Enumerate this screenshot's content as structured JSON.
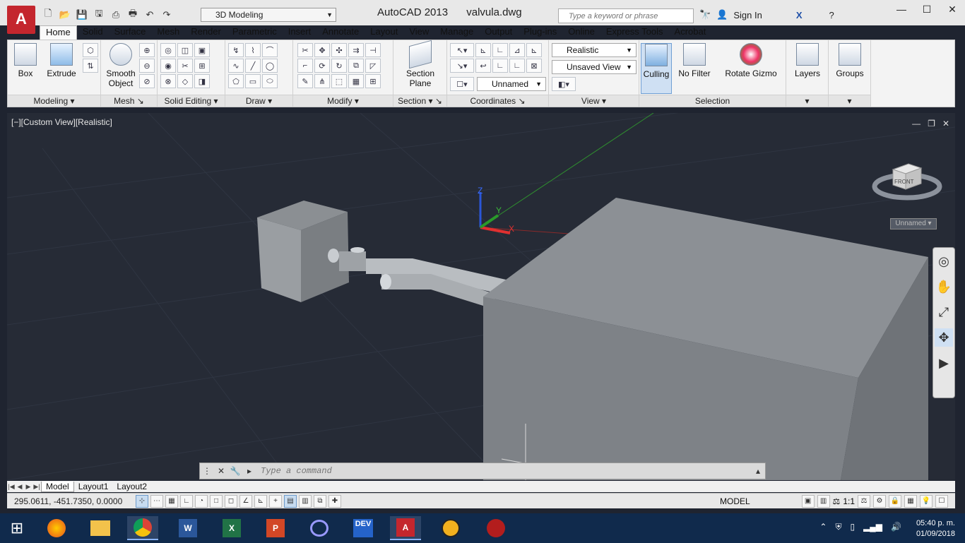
{
  "titlebar": {
    "app_name": "AutoCAD 2013",
    "file_name": "valvula.dwg",
    "workspace": "3D Modeling",
    "search_placeholder": "Type a keyword or phrase",
    "sign_in": "Sign In"
  },
  "tabs": [
    "Home",
    "Solid",
    "Surface",
    "Mesh",
    "Render",
    "Parametric",
    "Insert",
    "Annotate",
    "Layout",
    "View",
    "Manage",
    "Output",
    "Plug-ins",
    "Online",
    "Express Tools",
    "Acrobat"
  ],
  "active_tab": "Home",
  "ribbon": {
    "modeling": {
      "title": "Modeling",
      "box": "Box",
      "extrude": "Extrude"
    },
    "mesh": {
      "title": "Mesh",
      "smooth_object_line1": "Smooth",
      "smooth_object_line2": "Object"
    },
    "solid_editing": {
      "title": "Solid Editing"
    },
    "draw": {
      "title": "Draw"
    },
    "modify": {
      "title": "Modify"
    },
    "section": {
      "title": "Section",
      "plane_line1": "Section",
      "plane_line2": "Plane"
    },
    "coordinates": {
      "title": "Coordinates",
      "ucs_value": "Unnamed"
    },
    "view": {
      "title": "View",
      "visual_style": "Realistic",
      "saved_view": "Unsaved View"
    },
    "selection": {
      "title": "Selection",
      "culling": "Culling",
      "no_filter": "No Filter",
      "rotate_gizmo": "Rotate Gizmo"
    },
    "layers": {
      "label": "Layers"
    },
    "groups": {
      "label": "Groups"
    }
  },
  "viewport": {
    "label": "[−][Custom View][Realistic]",
    "viewcube_face": "FRONT",
    "ucs_name": "Unnamed",
    "axis_x": "X",
    "axis_y": "Y",
    "axis_z": "Z"
  },
  "command": {
    "placeholder": "Type a command"
  },
  "layout_tabs": [
    "Model",
    "Layout1",
    "Layout2"
  ],
  "status": {
    "coordinates": "295.0611, -451.7350, 0.0000",
    "space": "MODEL",
    "scale": "1:1"
  },
  "taskbar": {
    "time": "05:40 p. m.",
    "date": "01/09/2018",
    "apps": [
      "start-icon",
      "firefox-icon",
      "file-explorer-icon",
      "chrome-icon",
      "word-icon",
      "excel-icon",
      "powerpoint-icon",
      "geogebra-icon",
      "dev-icon",
      "autocad-icon",
      "app-icon-1",
      "app-icon-2"
    ]
  },
  "colors": {
    "accent": "#c4262e",
    "viewport_bg": "#262b36",
    "taskbar_bg": "#102a4c"
  }
}
